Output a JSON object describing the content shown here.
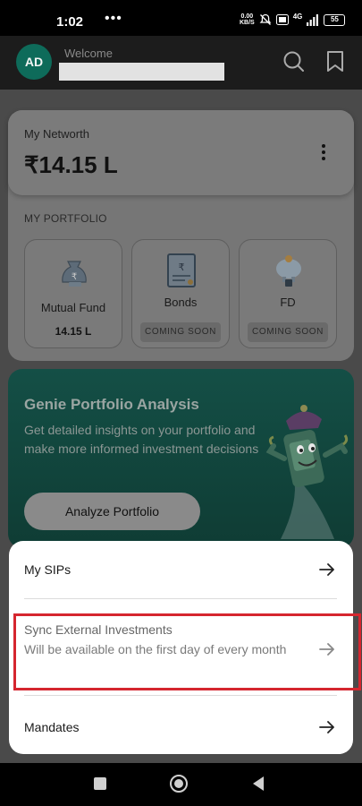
{
  "status_bar": {
    "time": "1:02",
    "more": "•••",
    "net_speed_value": "0.00",
    "net_speed_unit": "KB/S",
    "network_type": "4G",
    "battery": "55"
  },
  "header": {
    "avatar_initials": "AD",
    "welcome": "Welcome",
    "icons": [
      "search-icon",
      "bookmark-icon"
    ]
  },
  "networth": {
    "label": "My Networth",
    "value": "₹14.15 L"
  },
  "portfolio": {
    "heading": "MY PORTFOLIO",
    "tiles": [
      {
        "title": "Mutual Fund",
        "value": "14.15 L",
        "icon": "mutual-fund-icon"
      },
      {
        "title": "Bonds",
        "badge": "COMING SOON",
        "icon": "bonds-icon"
      },
      {
        "title": "FD",
        "badge": "COMING SOON",
        "icon": "fd-icon"
      }
    ]
  },
  "genie": {
    "title": "Genie Portfolio Analysis",
    "description": "Get detailed insights on your portfolio and make more informed investment decisions",
    "button": "Analyze Portfolio"
  },
  "sheet": {
    "items": [
      {
        "label": "My SIPs"
      },
      {
        "label": "Sync External Investments",
        "subtitle": "Will be available on the first day of every month",
        "disabled": true
      },
      {
        "label": "Mandates"
      }
    ]
  },
  "colors": {
    "brand": "#0e6b5a",
    "highlight": "#d5262f"
  }
}
